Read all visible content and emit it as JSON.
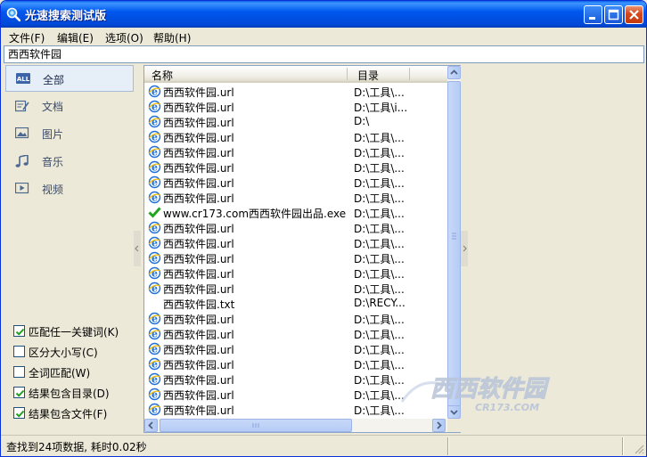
{
  "window": {
    "title": "光速搜索测试版"
  },
  "menu": [
    {
      "label": "文件(F)"
    },
    {
      "label": "编辑(E)"
    },
    {
      "label": "选项(O)"
    },
    {
      "label": "帮助(H)"
    }
  ],
  "search": {
    "value": "西西软件园"
  },
  "categories": [
    {
      "label": "全部",
      "icon": "all-icon",
      "selected": true
    },
    {
      "label": "文档",
      "icon": "document-icon"
    },
    {
      "label": "图片",
      "icon": "picture-icon"
    },
    {
      "label": "音乐",
      "icon": "music-icon"
    },
    {
      "label": "视频",
      "icon": "video-icon"
    }
  ],
  "options": [
    {
      "label": "匹配任一关键词(K)",
      "checked": true
    },
    {
      "label": "区分大小写(C)",
      "checked": false
    },
    {
      "label": "全词匹配(W)",
      "checked": false
    },
    {
      "label": "结果包含目录(D)",
      "checked": true
    },
    {
      "label": "结果包含文件(F)",
      "checked": true
    }
  ],
  "list": {
    "columns": {
      "name": "名称",
      "dir": "目录"
    },
    "rows": [
      {
        "name": "西西软件园.url",
        "dir": "D:\\工具\\...",
        "icon": "ie-url-icon"
      },
      {
        "name": "西西软件园.url",
        "dir": "D:\\工具\\i...",
        "icon": "ie-url-icon"
      },
      {
        "name": "西西软件园.url",
        "dir": "D:\\",
        "icon": "ie-url-icon"
      },
      {
        "name": "西西软件园.url",
        "dir": "D:\\工具\\...",
        "icon": "ie-url-icon"
      },
      {
        "name": "西西软件园.url",
        "dir": "D:\\工具\\...",
        "icon": "ie-url-icon"
      },
      {
        "name": "西西软件园.url",
        "dir": "D:\\工具\\...",
        "icon": "ie-url-icon"
      },
      {
        "name": "西西软件园.url",
        "dir": "D:\\工具\\...",
        "icon": "ie-url-icon"
      },
      {
        "name": "西西软件园.url",
        "dir": "D:\\工具\\...",
        "icon": "ie-url-icon"
      },
      {
        "name": "www.cr173.com西西软件园出品.exe",
        "dir": "D:\\工具\\...",
        "icon": "checkmark-exe-icon"
      },
      {
        "name": "西西软件园.url",
        "dir": "D:\\工具\\...",
        "icon": "ie-url-icon"
      },
      {
        "name": "西西软件园.url",
        "dir": "D:\\工具\\...",
        "icon": "ie-url-icon"
      },
      {
        "name": "西西软件园.url",
        "dir": "D:\\工具\\...",
        "icon": "ie-url-icon"
      },
      {
        "name": "西西软件园.url",
        "dir": "D:\\工具\\...",
        "icon": "ie-url-icon"
      },
      {
        "name": "西西软件园.url",
        "dir": "D:\\工具\\...",
        "icon": "ie-url-icon"
      },
      {
        "name": "西西软件园.txt",
        "dir": "D:\\RECY...",
        "icon": "none"
      },
      {
        "name": "西西软件园.url",
        "dir": "D:\\工具\\...",
        "icon": "ie-url-icon"
      },
      {
        "name": "西西软件园.url",
        "dir": "D:\\工具\\...",
        "icon": "ie-url-icon"
      },
      {
        "name": "西西软件园.url",
        "dir": "D:\\工具\\...",
        "icon": "ie-url-icon"
      },
      {
        "name": "西西软件园.url",
        "dir": "D:\\工具\\...",
        "icon": "ie-url-icon"
      },
      {
        "name": "西西软件园.url",
        "dir": "D:\\工具\\...",
        "icon": "ie-url-icon"
      },
      {
        "name": "西西软件园.url",
        "dir": "D:\\工具\\...",
        "icon": "ie-url-icon"
      },
      {
        "name": "西西软件园.url",
        "dir": "D:\\工具\\...",
        "icon": "ie-url-icon"
      }
    ]
  },
  "status": {
    "text": "查找到24项数据, 耗时0.02秒"
  },
  "watermark": {
    "main": "西西软件园",
    "sub": "CR173.COM"
  },
  "colors": {
    "titlebar": "#0058EE",
    "accent": "#1E50B4",
    "face": "#ECE9D8"
  }
}
